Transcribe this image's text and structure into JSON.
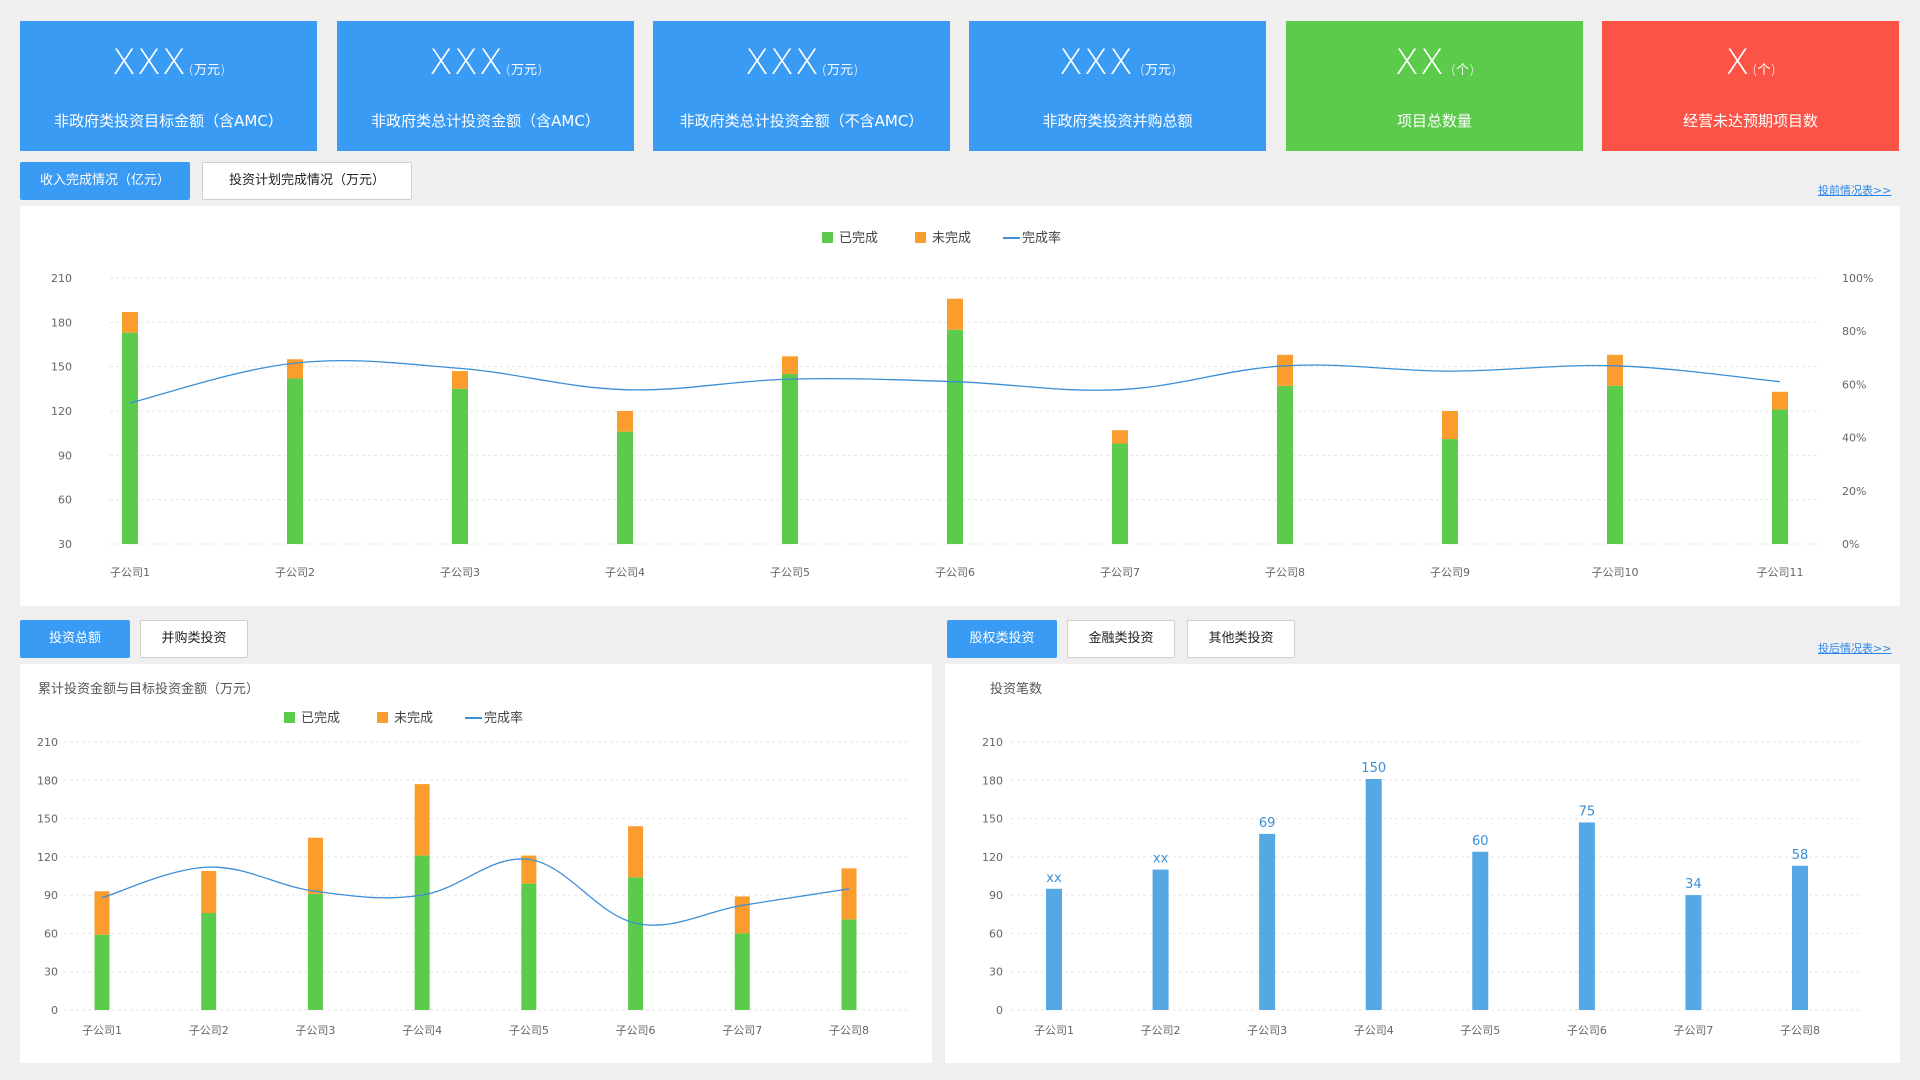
{
  "kpis": [
    {
      "value": "XXX",
      "unit": "(万元)",
      "label": "非政府类投资目标金额（含AMC）",
      "color": "#3a9bf5"
    },
    {
      "value": "XXX",
      "unit": "(万元)",
      "label": "非政府类总计投资金额（含AMC）",
      "color": "#3a9bf5"
    },
    {
      "value": "XXX",
      "unit": "(万元)",
      "label": "非政府类总计投资金额（不含AMC）",
      "color": "#3a9bf5"
    },
    {
      "value": "XXX",
      "unit": " (万元)",
      "label": "非政府类投资并购总额",
      "color": "#3a9bf5"
    },
    {
      "value": "XX",
      "unit": " (个)",
      "label": "项目总数量",
      "color": "#5ccb4b"
    },
    {
      "value": "X",
      "unit": "(个)",
      "label": "经营未达预期项目数",
      "color": "#fb5346"
    }
  ],
  "top_tabs": [
    "收入完成情况（亿元）",
    "投资计划完成情况（万元）"
  ],
  "top_link": "投前情况表>>",
  "bl_tabs": [
    "投资总额",
    "并购类投资"
  ],
  "br_tabs": [
    "股权类投资",
    "金融类投资",
    "其他类投资"
  ],
  "bottom_link": "投后情况表>>",
  "bl_title": "累计投资金额与目标投资金额（万元）",
  "br_title": "投资笔数",
  "legend": {
    "done": "已完成",
    "undone": "未完成",
    "rate": "完成率"
  },
  "colors": {
    "done": "#5ccb4b",
    "undone": "#fa9d2c",
    "rate": "#3a8fd8",
    "bar": "#55a8e3",
    "label": "#3a8fd8"
  },
  "chart_data": [
    {
      "type": "bar",
      "stacked": true,
      "categories": [
        "子公司1",
        "子公司2",
        "子公司3",
        "子公司4",
        "子公司5",
        "子公司6",
        "子公司7",
        "子公司8",
        "子公司9",
        "子公司10",
        "子公司11"
      ],
      "series": [
        {
          "name": "已完成",
          "values": [
            173,
            142,
            135,
            106,
            145,
            175,
            98,
            137,
            101,
            137,
            121
          ]
        },
        {
          "name": "未完成",
          "values": [
            14,
            13,
            12,
            14,
            12,
            21,
            9,
            21,
            19,
            21,
            12
          ]
        },
        {
          "name": "完成率",
          "axis": "right",
          "values": [
            53,
            68,
            66,
            58,
            62,
            61,
            58,
            67,
            65,
            67,
            61
          ]
        }
      ],
      "y_ticks": [
        30,
        60,
        90,
        120,
        150,
        180,
        210
      ],
      "ylim": [
        30,
        210
      ],
      "y2_ticks": [
        "0%",
        "20%",
        "40%",
        "60%",
        "80%",
        "100%"
      ],
      "y2lim": [
        0,
        100
      ],
      "grid": true,
      "legend": "top-center"
    },
    {
      "type": "bar",
      "stacked": true,
      "categories": [
        "子公司1",
        "子公司2",
        "子公司3",
        "子公司4",
        "子公司5",
        "子公司6",
        "子公司7",
        "子公司8"
      ],
      "series": [
        {
          "name": "已完成",
          "values": [
            59,
            76,
            91,
            121,
            99,
            104,
            60,
            71
          ]
        },
        {
          "name": "未完成",
          "values": [
            34,
            33,
            44,
            56,
            22,
            40,
            29,
            40
          ]
        },
        {
          "name": "完成率",
          "values": [
            88,
            112,
            93,
            90,
            118,
            68,
            82,
            95
          ]
        }
      ],
      "y_ticks": [
        0,
        30,
        60,
        90,
        120,
        150,
        180,
        210
      ],
      "ylim": [
        0,
        210
      ],
      "grid": true,
      "legend": "top-left"
    },
    {
      "type": "bar",
      "categories": [
        "子公司1",
        "子公司2",
        "子公司3",
        "子公司4",
        "子公司5",
        "子公司6",
        "子公司7",
        "子公司8"
      ],
      "values": [
        95,
        110,
        138,
        181,
        124,
        147,
        90,
        113
      ],
      "data_labels": [
        "xx",
        "xx",
        "69",
        "150",
        "60",
        "75",
        "34",
        "58"
      ],
      "y_ticks": [
        0,
        30,
        60,
        90,
        120,
        150,
        180,
        210
      ],
      "ylim": [
        0,
        210
      ],
      "grid": true
    }
  ]
}
